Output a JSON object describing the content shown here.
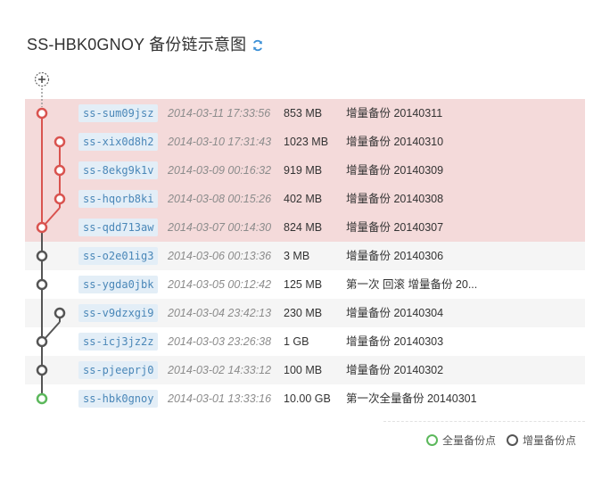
{
  "header": {
    "title": "SS-HBK0GNOY 备份链示意图",
    "refresh_icon": "refresh-icon"
  },
  "colors": {
    "highlight_row": "#f4dada",
    "alt_row": "#f5f5f5",
    "red_node": "#d9534f",
    "gray_node": "#555555",
    "green_node": "#5cb85c",
    "snapshot_tag_bg": "#e3eef7",
    "snapshot_tag_text": "#4a87b8"
  },
  "snapshots": [
    {
      "id": "ss-sum09jsz",
      "time": "2014-03-11 17:33:56",
      "size": "853 MB",
      "desc": "增量备份 20140311"
    },
    {
      "id": "ss-xix0d8h2",
      "time": "2014-03-10 17:31:43",
      "size": "1023 MB",
      "desc": "增量备份 20140310"
    },
    {
      "id": "ss-8ekg9k1v",
      "time": "2014-03-09 00:16:32",
      "size": "919 MB",
      "desc": "增量备份 20140309"
    },
    {
      "id": "ss-hqorb8ki",
      "time": "2014-03-08 00:15:26",
      "size": "402 MB",
      "desc": "增量备份 20140308"
    },
    {
      "id": "ss-qdd713aw",
      "time": "2014-03-07 00:14:30",
      "size": "824 MB",
      "desc": "增量备份 20140307"
    },
    {
      "id": "ss-o2e01ig3",
      "time": "2014-03-06 00:13:36",
      "size": "3 MB",
      "desc": "增量备份 20140306"
    },
    {
      "id": "ss-ygda0jbk",
      "time": "2014-03-05 00:12:42",
      "size": "125 MB",
      "desc": "第一次 回滚 增量备份 20..."
    },
    {
      "id": "ss-v9dzxgi9",
      "time": "2014-03-04 23:42:13",
      "size": "230 MB",
      "desc": "增量备份 20140304"
    },
    {
      "id": "ss-icj3jz2z",
      "time": "2014-03-03 23:26:38",
      "size": "1 GB",
      "desc": "增量备份 20140303"
    },
    {
      "id": "ss-pjeeprj0",
      "time": "2014-03-02 14:33:12",
      "size": "100 MB",
      "desc": "增量备份 20140302"
    },
    {
      "id": "ss-hbk0gnoy",
      "time": "2014-03-01 13:33:16",
      "size": "10.00 GB",
      "desc": "第一次全量备份 20140301"
    }
  ],
  "legend": {
    "full_label": "全量备份点",
    "incremental_label": "增量备份点"
  }
}
